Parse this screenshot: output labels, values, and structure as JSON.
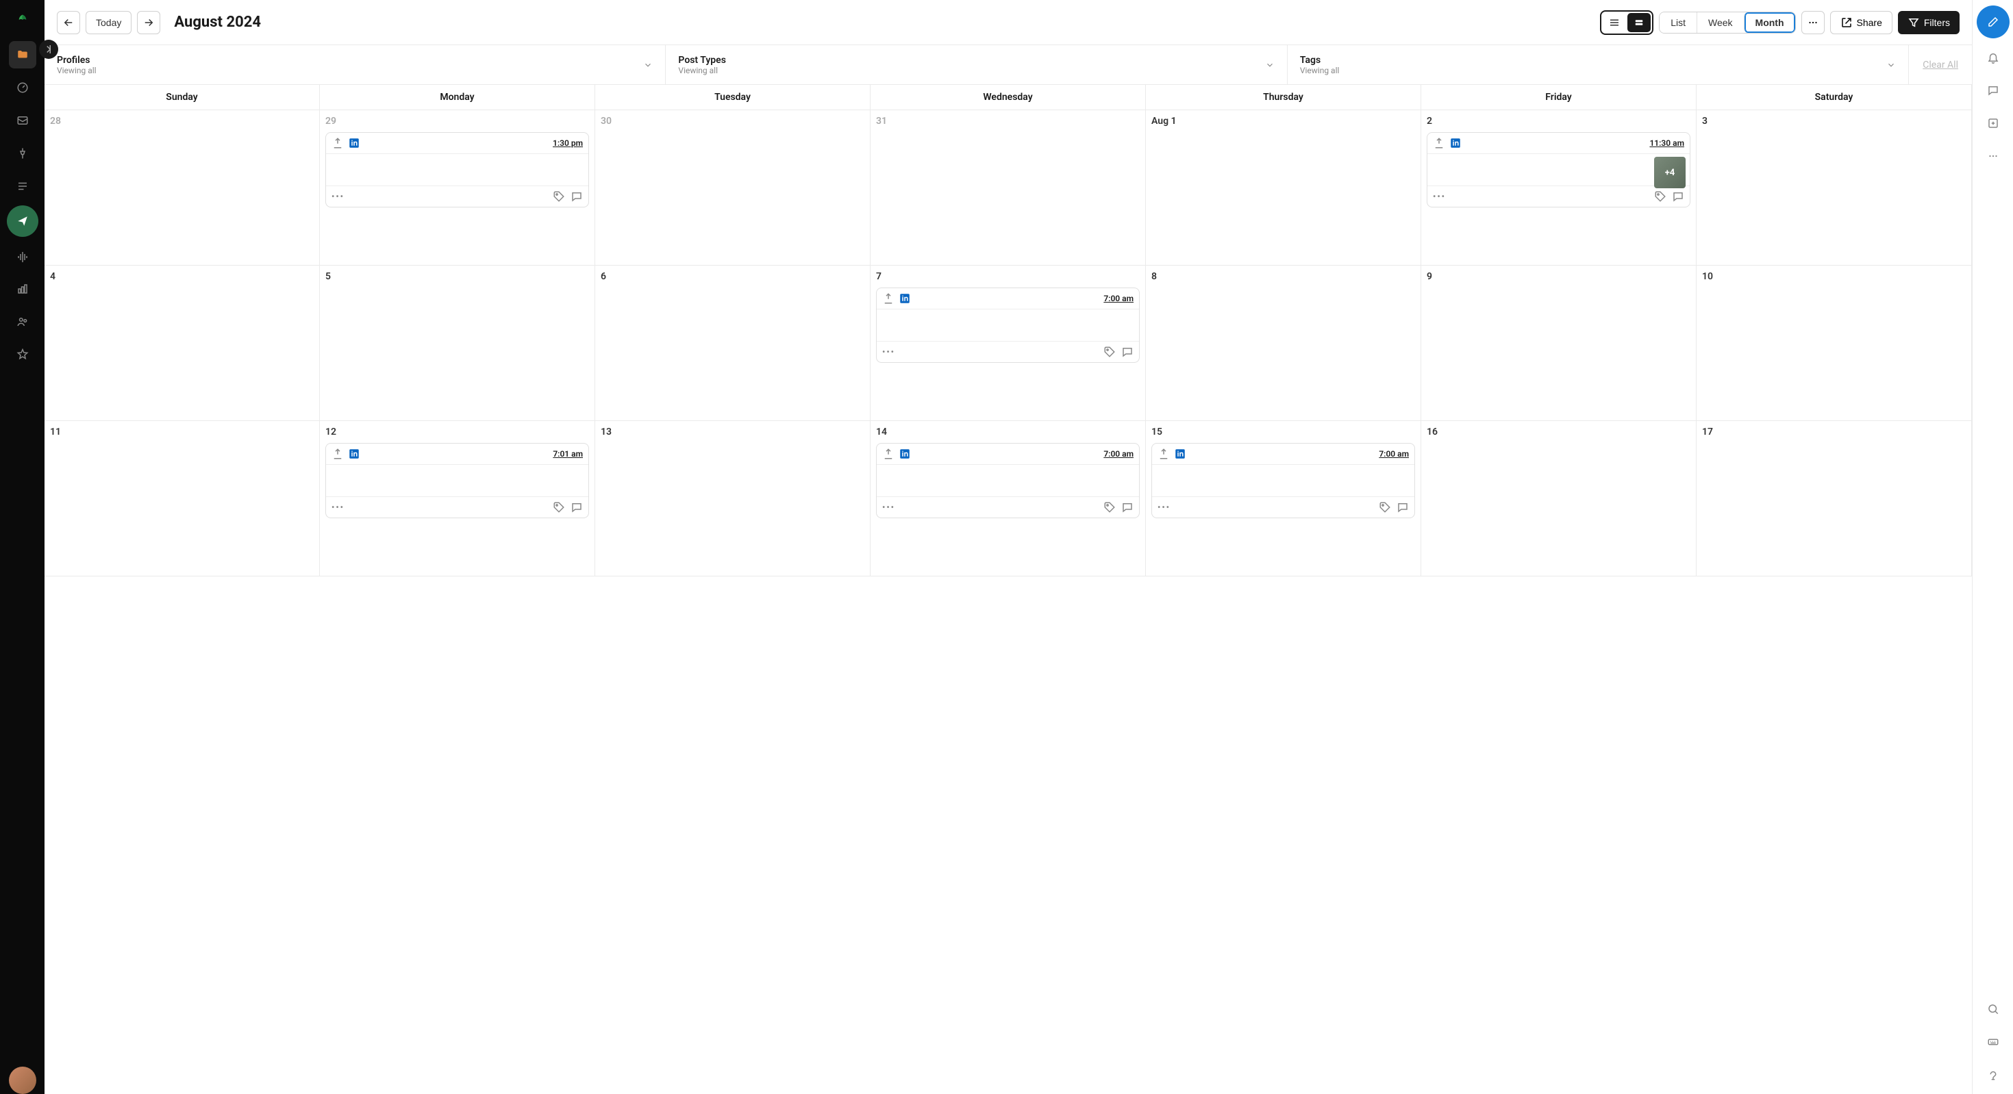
{
  "toolbar": {
    "today_label": "Today",
    "title": "August 2024",
    "view_list": "List",
    "view_week": "Week",
    "view_month": "Month",
    "share_label": "Share",
    "filters_label": "Filters"
  },
  "filters": {
    "profiles": {
      "label": "Profiles",
      "sub": "Viewing all"
    },
    "post_types": {
      "label": "Post Types",
      "sub": "Viewing all"
    },
    "tags": {
      "label": "Tags",
      "sub": "Viewing all"
    },
    "clear_all": "Clear All"
  },
  "day_headers": [
    "Sunday",
    "Monday",
    "Tuesday",
    "Wednesday",
    "Thursday",
    "Friday",
    "Saturday"
  ],
  "dates": {
    "r0": [
      "28",
      "29",
      "30",
      "31",
      "Aug 1",
      "2",
      "3"
    ],
    "r1": [
      "4",
      "5",
      "6",
      "7",
      "8",
      "9",
      "10"
    ],
    "r2": [
      "11",
      "12",
      "13",
      "14",
      "15",
      "16",
      "17"
    ]
  },
  "posts": {
    "jul29": {
      "time": "1:30 pm"
    },
    "aug2": {
      "time": "11:30 am",
      "thumb_badge": "+4"
    },
    "aug7": {
      "time": "7:00 am"
    },
    "aug12": {
      "time": "7:01 am"
    },
    "aug14": {
      "time": "7:00 am"
    },
    "aug15": {
      "time": "7:00 am"
    }
  }
}
